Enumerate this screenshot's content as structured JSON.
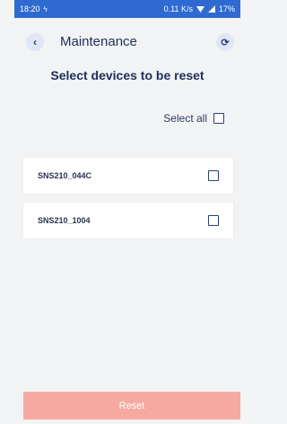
{
  "statusbar": {
    "time": "18:20",
    "notification_icon": "usb-icon",
    "network_speed": "0.11 K/s",
    "battery": "17%"
  },
  "header": {
    "title": "Maintenance",
    "back_icon": "back-icon",
    "refresh_icon": "refresh-icon"
  },
  "main": {
    "subtitle": "Select devices to be reset",
    "select_all_label": "Select all",
    "devices": [
      {
        "name": "SNS210_044C",
        "checked": false
      },
      {
        "name": "SNS210_1004",
        "checked": false
      }
    ],
    "reset_label": "Reset"
  },
  "colors": {
    "statusbar": "#2e6ad1",
    "primary_text": "#1f2e5a",
    "reset_disabled": "#f5a9a1"
  }
}
